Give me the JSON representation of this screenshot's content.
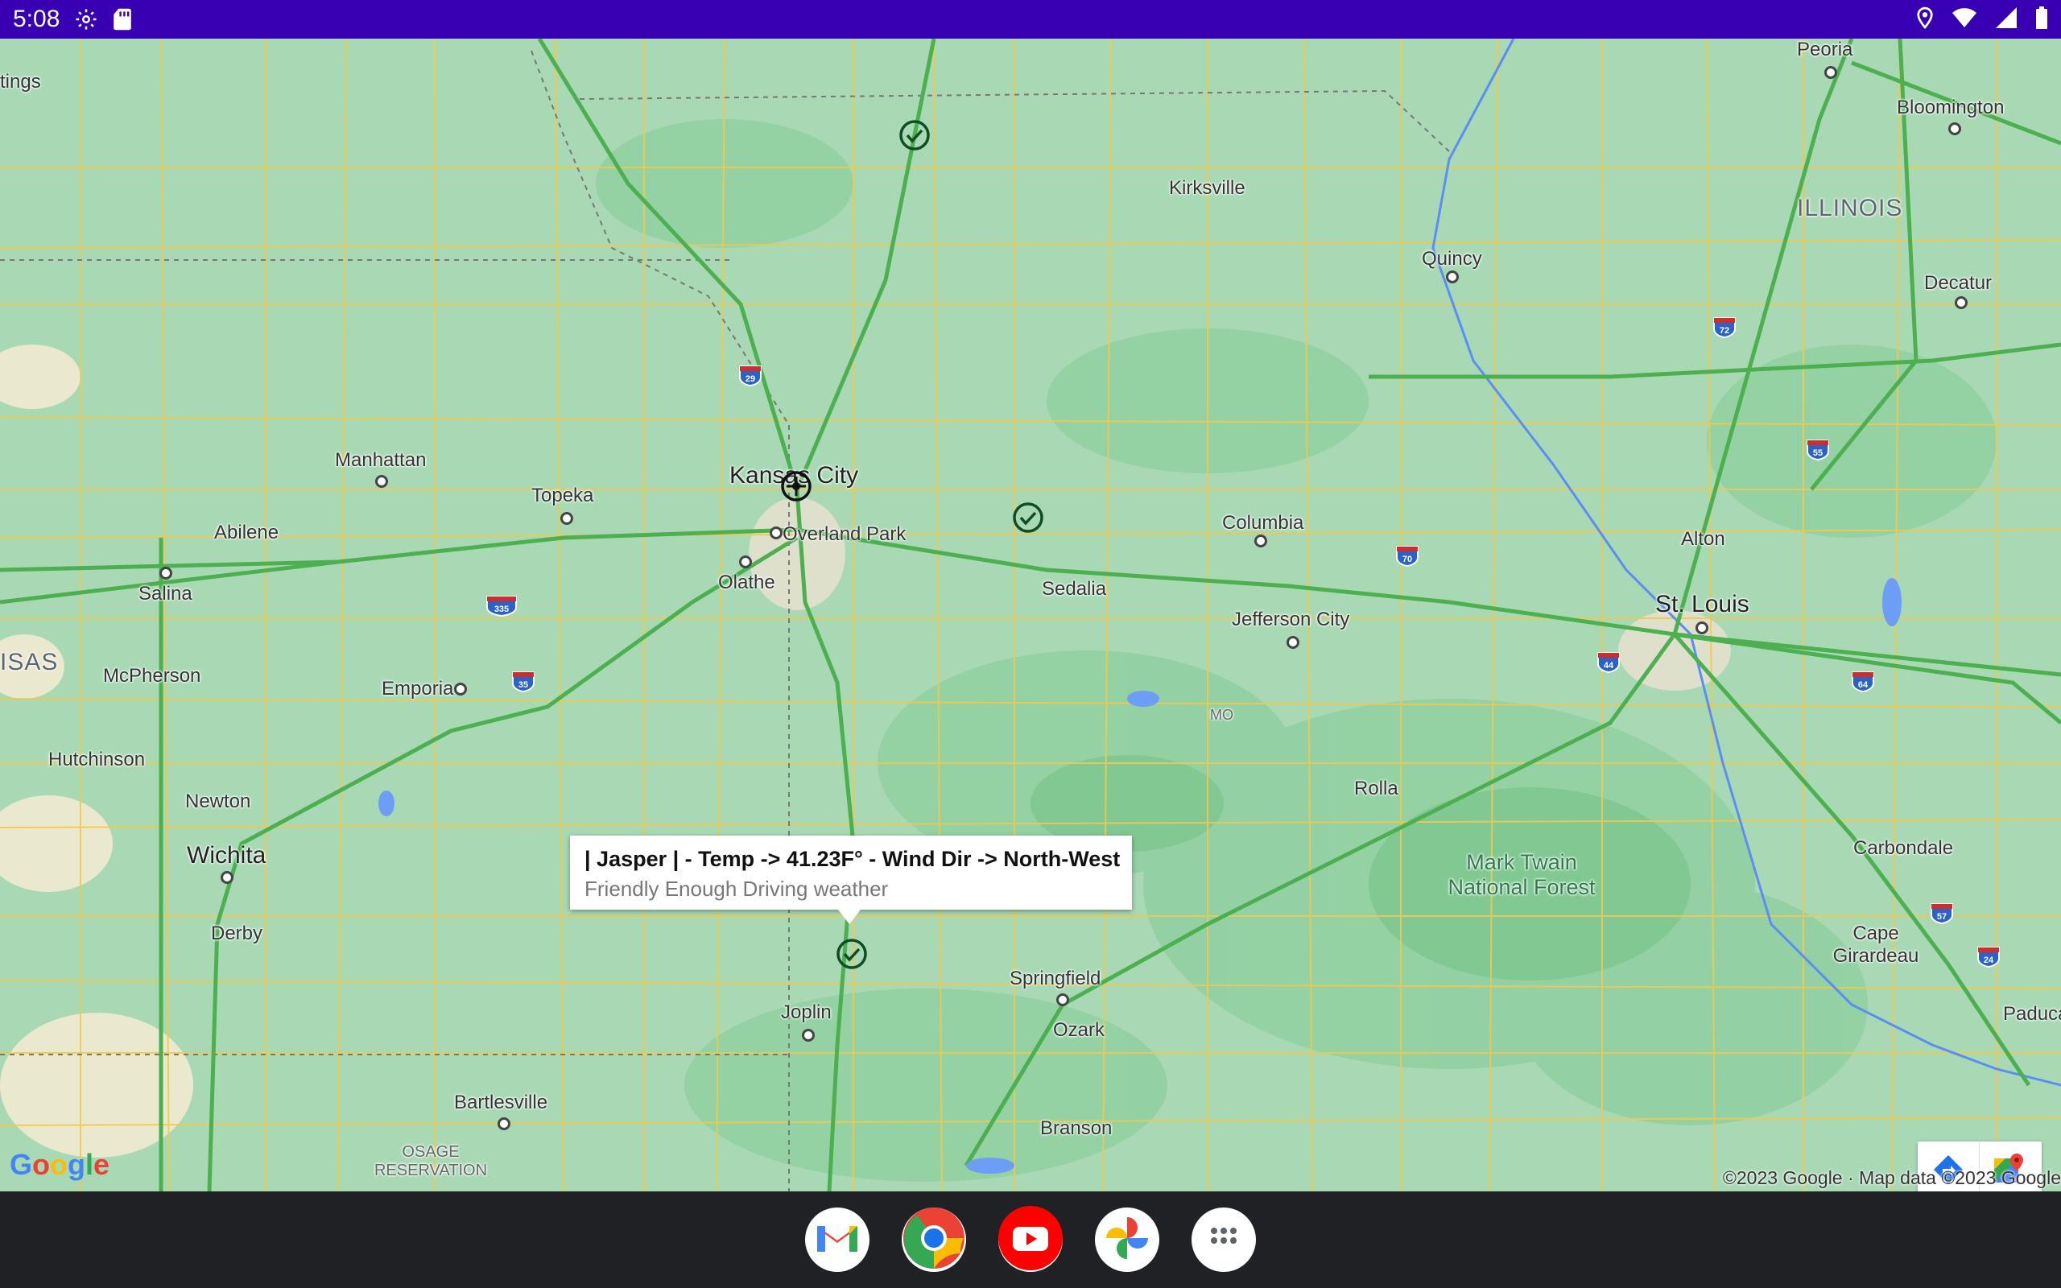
{
  "status_bar": {
    "time": "5:08",
    "left_icons": [
      "gear-icon",
      "sd-card-icon"
    ],
    "right_icons": [
      "location-icon",
      "wifi-icon",
      "signal-icon",
      "battery-icon"
    ]
  },
  "map": {
    "regions": {
      "state_illinois": "ILLINOIS",
      "state_kansas_partial": "ISAS",
      "state_missouri_abbr": "MO",
      "forest": "Mark Twain National Forest",
      "reservation": "OSAGE RESERVATION",
      "edge_label": "tings"
    },
    "cities": {
      "peoria": "Peoria",
      "bloomington": "Bloomington",
      "kirksville": "Kirksville",
      "quincy": "Quincy",
      "decatur": "Decatur",
      "manhattan": "Manhattan",
      "topeka": "Topeka",
      "kansas_city": "Kansas City",
      "overland_park": "Overland Park",
      "abilene": "Abilene",
      "olathe": "Olathe",
      "columbia": "Columbia",
      "salina": "Salina",
      "sedalia": "Sedalia",
      "alton": "Alton",
      "st_louis": "St. Louis",
      "jefferson_city": "Jefferson City",
      "mcpherson": "McPherson",
      "emporia": "Emporia",
      "hutchinson": "Hutchinson",
      "newton": "Newton",
      "rolla": "Rolla",
      "carbondale": "Carbondale",
      "wichita": "Wichita",
      "derby": "Derby",
      "cape_girardeau": "Cape Girardeau",
      "springfield": "Springfield",
      "joplin": "Joplin",
      "ozark": "Ozark",
      "paducah": "Paduca",
      "bartlesville": "Bartlesville",
      "branson": "Branson"
    },
    "shields": {
      "i29": "29",
      "i72": "72",
      "i55": "55",
      "i70": "70",
      "i335": "335",
      "i44": "44",
      "i64": "64",
      "i35": "35",
      "i57": "57",
      "i24": "24"
    },
    "markers": [
      "check-circle-icon",
      "check-circle-icon",
      "check-circle-icon",
      "current-location-icon"
    ]
  },
  "info_window": {
    "title": "| Jasper | - Temp -> 41.23F° - Wind Dir -> North-West",
    "snippet": "Friendly Enough Driving weather"
  },
  "attribution": {
    "logo": "Google",
    "copyright": "©2023 Google · Map data ©2023 Google"
  },
  "map_toolbar": [
    "directions-icon",
    "google-maps-icon"
  ],
  "dock": {
    "apps": [
      "gmail-icon",
      "chrome-icon",
      "youtube-icon",
      "photos-icon",
      "app-drawer-icon"
    ]
  },
  "colors": {
    "status_bar": "#3700b3",
    "map_land": "#a8d9b4",
    "highway": "#4caf50",
    "road": "#f5c242",
    "dock": "#202124"
  }
}
